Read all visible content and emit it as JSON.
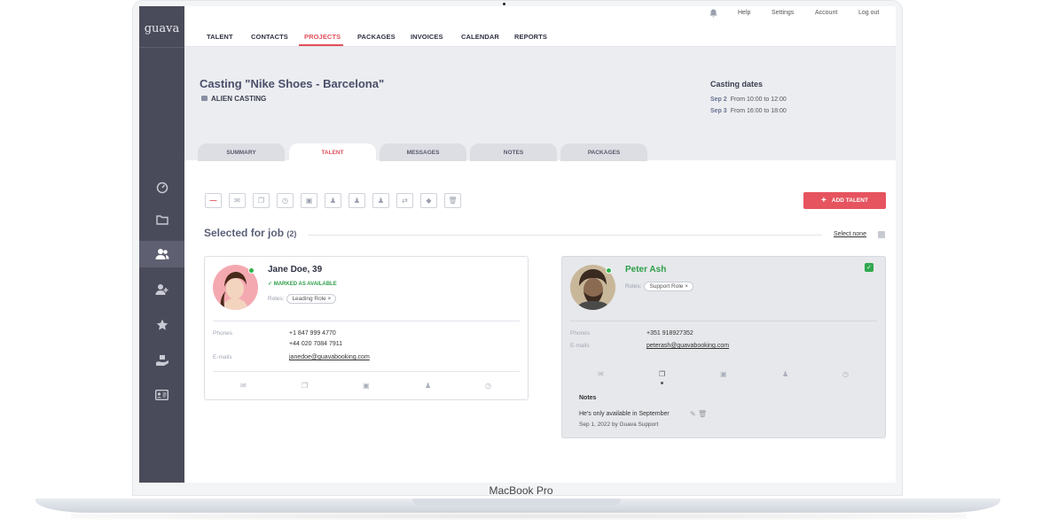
{
  "app": {
    "logo": "guava",
    "device_label": "MacBook Pro"
  },
  "topnav": {
    "links": [
      "TALENT",
      "CONTACTS",
      "PROJECTS",
      "PACKAGES",
      "INVOICES",
      "CALENDAR",
      "REPORTS"
    ],
    "active": "PROJECTS",
    "utility": [
      "Help",
      "Settings",
      "Account",
      "Log out"
    ]
  },
  "sidebar": {
    "items": [
      "dashboard-icon",
      "folder-icon",
      "users-icon",
      "add-user-icon",
      "star-icon",
      "hand-gift-icon",
      "id-card-icon"
    ],
    "active": "users-icon"
  },
  "header": {
    "title": "Casting \"Nike Shoes - Barcelona\"",
    "subtitle": "ALIEN CASTING",
    "dates_title": "Casting dates",
    "dates": [
      {
        "day": "Sep 2",
        "time": "From 10:00 to 12:00"
      },
      {
        "day": "Sep 3",
        "time": "From 16:00 to 18:00"
      }
    ]
  },
  "tabs": [
    "SUMMARY",
    "TALENT",
    "MESSAGES",
    "NOTES",
    "PACKAGES"
  ],
  "active_tab": "TALENT",
  "toolbar": {
    "add_label": "ADD TALENT",
    "add_icon": "+"
  },
  "section": {
    "title": "Selected for job",
    "count": "(2)",
    "select_none": "Select none"
  },
  "cards": [
    {
      "name": "Jane Doe, 39",
      "status": "MARKED AS AVAILABLE",
      "roles_label": "Roles:",
      "role": "Leading Role",
      "phones_label": "Phones",
      "phones": [
        "+1 847 999 4770",
        "+44 020 7084 7911"
      ],
      "emails_label": "E-mails",
      "email": "janedoe@guavabooking.com",
      "selected": false
    },
    {
      "name": "Peter Ash",
      "roles_label": "Roles:",
      "role": "Support Role",
      "phones_label": "Phones",
      "phones": [
        "+351 918927352"
      ],
      "emails_label": "E-mails",
      "email": "peterash@guavabooking.com",
      "selected": true,
      "notes_title": "Notes",
      "note": "He's only available in September",
      "note_meta": "Sep 1, 2022 by Guava Support"
    }
  ],
  "colors": {
    "accent": "#e0505c",
    "sidebar": "#4a4b5a",
    "available": "#2f9e4a"
  }
}
